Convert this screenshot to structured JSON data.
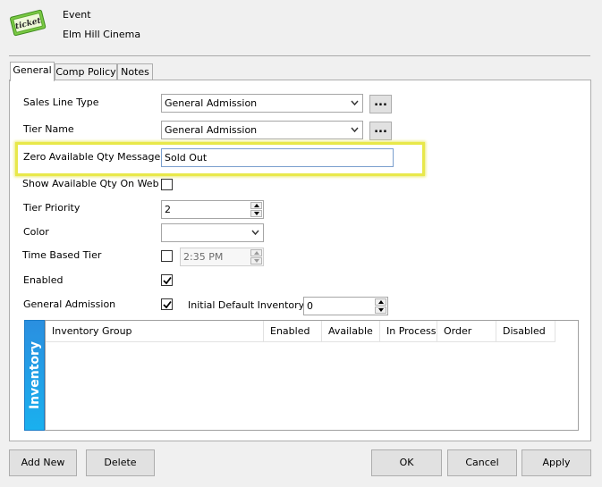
{
  "header": {
    "line1": "Event",
    "line2": "Elm Hill Cinema",
    "icon_text": "ticket"
  },
  "tabs": [
    {
      "label": "General",
      "active": true
    },
    {
      "label": "Comp Policy",
      "active": false
    },
    {
      "label": "Notes",
      "active": false
    }
  ],
  "form": {
    "sales_line_type": {
      "label": "Sales Line Type",
      "value": "General Admission",
      "more": "..."
    },
    "tier_name": {
      "label": "Tier Name",
      "value": "General Admission",
      "more": "..."
    },
    "zero_qty_message": {
      "label": "Zero Available Qty Message",
      "value": "Sold Out"
    },
    "show_qty_on_web": {
      "label": "Show Available Qty On Web",
      "checked": false
    },
    "tier_priority": {
      "label": "Tier Priority",
      "value": "2"
    },
    "color": {
      "label": "Color",
      "value": ""
    },
    "time_based_tier": {
      "label": "Time Based Tier",
      "checked": false,
      "time": "2:35 PM"
    },
    "enabled": {
      "label": "Enabled",
      "checked": true
    },
    "general_admission": {
      "label": "General Admission",
      "checked": true
    },
    "initial_default_inventory": {
      "label": "Initial Default Inventory",
      "value": "0"
    }
  },
  "inventory": {
    "side_label": "Inventory",
    "columns": [
      "Inventory Group",
      "Enabled",
      "Available",
      "In Process",
      "Order",
      "Disabled"
    ],
    "rows": []
  },
  "buttons": {
    "add_new": "Add New",
    "delete": "Delete",
    "ok": "OK",
    "cancel": "Cancel",
    "apply": "Apply"
  },
  "colors": {
    "highlight": "#e8e84a",
    "inventory_accent": "#1a9be6",
    "ticket_green": "#7ac943"
  }
}
